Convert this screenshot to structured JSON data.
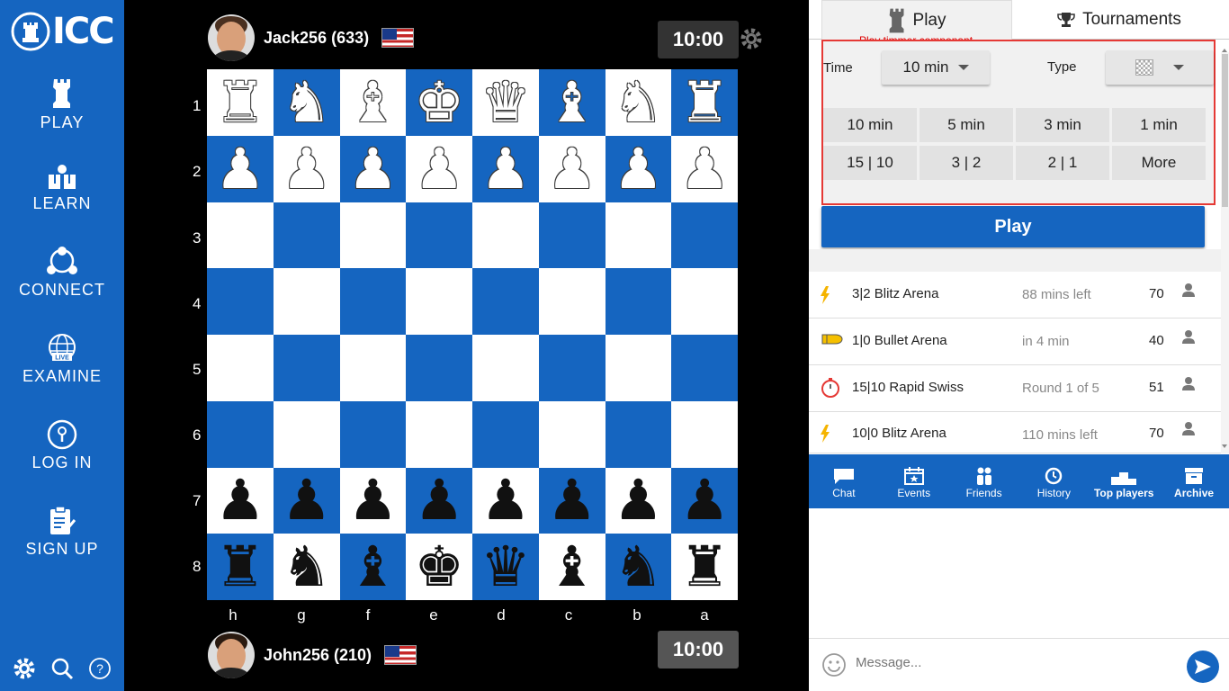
{
  "brand": {
    "logo_text": "ICC"
  },
  "sidebar": {
    "items": [
      {
        "label": "PLAY",
        "icon": "rook-icon"
      },
      {
        "label": "LEARN",
        "icon": "learn-icon"
      },
      {
        "label": "CONNECT",
        "icon": "connect-icon"
      },
      {
        "label": "EXAMINE",
        "icon": "live-globe-icon"
      },
      {
        "label": "LOG IN",
        "icon": "login-icon"
      },
      {
        "label": "SIGN UP",
        "icon": "signup-icon"
      }
    ],
    "bottom_icons": [
      "gear-icon",
      "search-icon",
      "help-icon"
    ]
  },
  "game": {
    "top_player": {
      "name": "Jack256 (633)",
      "clock": "10:00"
    },
    "bottom_player": {
      "name": "John256 (210)",
      "clock": "10:00"
    },
    "ranks": [
      "1",
      "2",
      "3",
      "4",
      "5",
      "6",
      "7",
      "8"
    ],
    "files": [
      "h",
      "g",
      "f",
      "e",
      "d",
      "c",
      "b",
      "a"
    ],
    "position": [
      [
        "wR",
        "wN",
        "wB",
        "wK",
        "wQ",
        "wB",
        "wN",
        "wR"
      ],
      [
        "wP",
        "wP",
        "wP",
        "wP",
        "wP",
        "wP",
        "wP",
        "wP"
      ],
      [
        "",
        "",
        "",
        "",
        "",
        "",
        "",
        ""
      ],
      [
        "",
        "",
        "",
        "",
        "",
        "",
        "",
        ""
      ],
      [
        "",
        "",
        "",
        "",
        "",
        "",
        "",
        ""
      ],
      [
        "",
        "",
        "",
        "",
        "",
        "",
        "",
        ""
      ],
      [
        "bP",
        "bP",
        "bP",
        "bP",
        "bP",
        "bP",
        "bP",
        "bP"
      ],
      [
        "bR",
        "bN",
        "bB",
        "bK",
        "bQ",
        "bB",
        "bN",
        "bR"
      ]
    ],
    "colors": {
      "dark_square": "#1565c0",
      "light_square": "#ffffff"
    }
  },
  "panel": {
    "tabs": {
      "play": "Play",
      "tournaments": "Tournaments"
    },
    "annotation": "Play timmer componant",
    "time_label": "Time",
    "time_value": "10 min",
    "type_label": "Type",
    "time_buttons": [
      "10 min",
      "5 min",
      "3 min",
      "1 min",
      "15 | 10",
      "3 | 2",
      "2 | 1",
      "More"
    ],
    "play_button": "Play",
    "tournaments": [
      {
        "icon": "lightning-icon",
        "name": "3|2 Blitz Arena",
        "status": "88 mins left",
        "count": "70"
      },
      {
        "icon": "bullet-icon",
        "name": "1|0 Bullet Arena",
        "status": "in 4 min",
        "count": "40"
      },
      {
        "icon": "stopwatch-icon",
        "name": "15|10 Rapid Swiss",
        "status": "Round 1 of 5",
        "count": "51"
      },
      {
        "icon": "lightning-icon",
        "name": "10|0 Blitz Arena",
        "status": "110 mins left",
        "count": "70"
      }
    ],
    "bottom_nav": [
      "Chat",
      "Events",
      "Friends",
      "History",
      "Top players",
      "Archive"
    ],
    "message_placeholder": "Message..."
  },
  "accent_color": "#1565c0"
}
